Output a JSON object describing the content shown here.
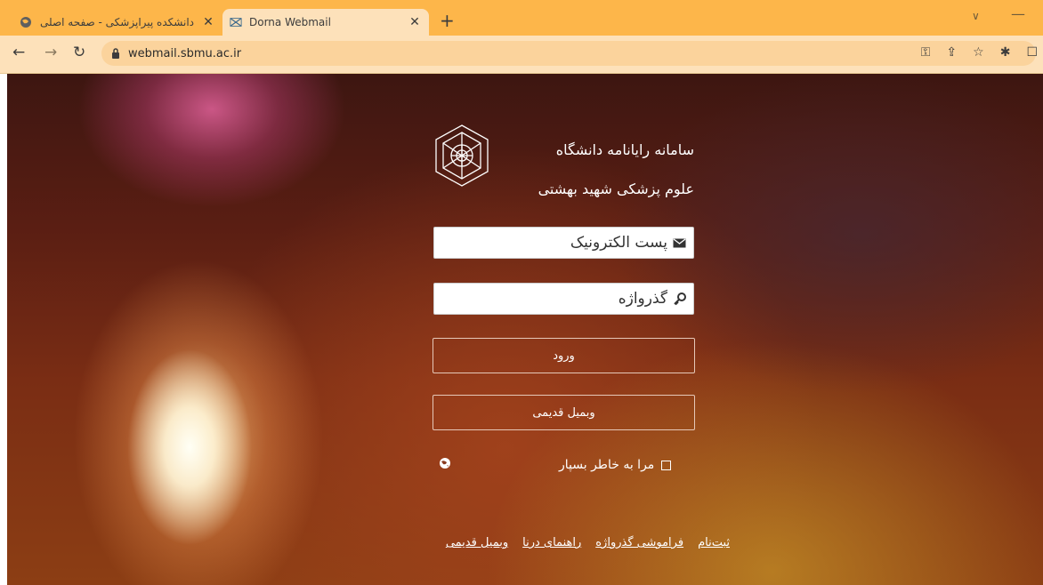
{
  "browser": {
    "tabs": [
      {
        "title": "دانشکده پیراپزشکی - صفحه اصلی",
        "active": false
      },
      {
        "title": "Dorna Webmail",
        "active": true
      }
    ],
    "url": "webmail.sbmu.ac.ir",
    "accent_color": "#fdb64a",
    "toolbar_color": "#fde1ba"
  },
  "site": {
    "title_line1": "سامانه رایانامه دانشگاه",
    "title_line2": "علوم پزشکی شهید بهشتی"
  },
  "login": {
    "email_placeholder": "پست الکترونیک",
    "password_placeholder": "گذرواژه",
    "login_button": "ورود",
    "old_webmail_button": "وبمیل قدیمی",
    "remember_me": "مرا به خاطر بسپار"
  },
  "footer": {
    "links": [
      "ثبت‌نام",
      "فراموشی گذرواژه",
      "راهنمای درنا",
      "وبمیل قدیمی"
    ]
  },
  "icons": {
    "email": "envelope-icon",
    "password": "key-icon",
    "language": "globe-icon"
  }
}
